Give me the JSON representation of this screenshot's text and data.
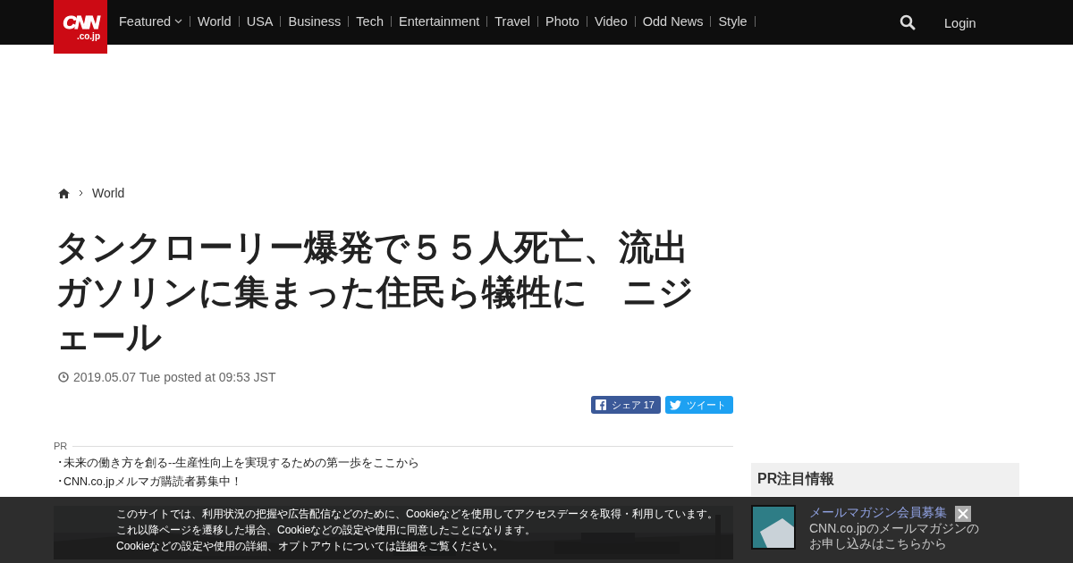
{
  "header": {
    "logo": {
      "main": "CNN",
      "sub": ".co.jp"
    },
    "nav": [
      {
        "label": "Featured",
        "kind": "dropdown"
      },
      {
        "label": "World",
        "kind": "link"
      },
      {
        "label": "USA",
        "kind": "link"
      },
      {
        "label": "Business",
        "kind": "link"
      },
      {
        "label": "Tech",
        "kind": "link"
      },
      {
        "label": "Entertainment",
        "kind": "link"
      },
      {
        "label": "Travel",
        "kind": "link"
      },
      {
        "label": "Photo",
        "kind": "link"
      },
      {
        "label": "Video",
        "kind": "link"
      },
      {
        "label": "Odd News",
        "kind": "link"
      },
      {
        "label": "Style",
        "kind": "link"
      }
    ],
    "login": "Login"
  },
  "breadcrumb": [
    "World"
  ],
  "article": {
    "title": "タンクローリー爆発で５５人死亡、流出ガソリンに集まった住民ら犠牲に　ニジェール",
    "date": "2019.05.07 Tue posted at 09:53 JST",
    "share": [
      {
        "kind": "facebook",
        "label": "シェア",
        "count": "17"
      },
      {
        "kind": "twitter",
        "label": "ツイート"
      }
    ],
    "pr": {
      "label": "PR",
      "items": [
        "･未来の働き方を創る--生産性向上を実現するための第一歩をここから",
        "･CNN.co.jpメルマガ購読者募集中！"
      ]
    }
  },
  "sidebar": {
    "heading": "PR注目情報",
    "items": [
      {
        "title": "メールマガジン会員募集",
        "text": "CNN.co.jpのメールマガジンのお申し込みはこちらから"
      }
    ]
  },
  "cookie_banner": {
    "lines": [
      "このサイトでは、利用状況の把握や広告配信などのために、Cookieなどを使用してアクセスデータを取得・利用しています。",
      "これ以降ページを遷移した場合、Cookieなどの設定や使用に同意したことになります。",
      {
        "before": "Cookieなどの設定や使用の詳細、オプトアウトについては",
        "link": "詳細",
        "after": "をご覧ください。"
      }
    ]
  }
}
